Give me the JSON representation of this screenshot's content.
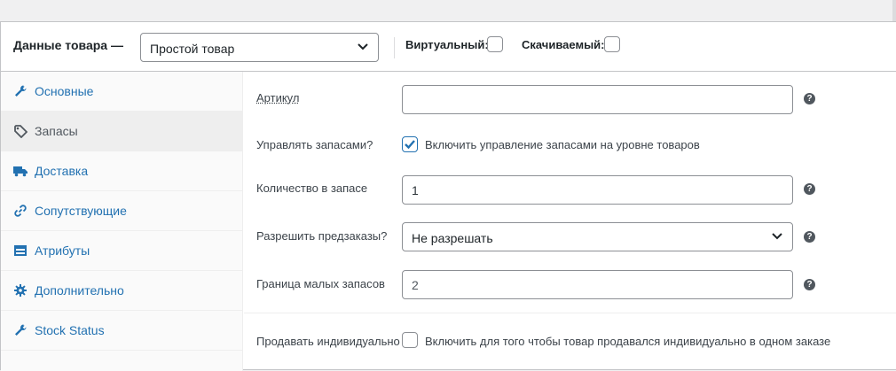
{
  "header": {
    "title": "Данные товара —",
    "product_type": {
      "selected": "Простой товар",
      "icon": "chevron-down-icon"
    },
    "virtual_label": "Виртуальный:",
    "virtual_checked": false,
    "downloadable_label": "Скачиваемый:",
    "downloadable_checked": false
  },
  "sidebar": {
    "items": [
      {
        "label": "Основные",
        "icon": "wrench-icon",
        "active": false
      },
      {
        "label": "Запасы",
        "icon": "tag-icon",
        "active": true
      },
      {
        "label": "Доставка",
        "icon": "truck-icon",
        "active": false
      },
      {
        "label": "Сопутствующие",
        "icon": "link-icon",
        "active": false
      },
      {
        "label": "Атрибуты",
        "icon": "table-icon",
        "active": false
      },
      {
        "label": "Дополнительно",
        "icon": "gear-icon",
        "active": false
      },
      {
        "label": "Stock Status",
        "icon": "wrench-icon",
        "active": false
      }
    ]
  },
  "inventory": {
    "sku": {
      "label": "Артикул",
      "value": ""
    },
    "manage_stock": {
      "label": "Управлять запасами?",
      "checked": true,
      "description": "Включить управление запасами на уровне товаров"
    },
    "stock_qty": {
      "label": "Количество в запасе",
      "value": "1"
    },
    "backorders": {
      "label": "Разрешить предзаказы?",
      "selected": "Не разрешать"
    },
    "low_stock": {
      "label": "Граница малых запасов",
      "placeholder": "2"
    },
    "sold_individually": {
      "label": "Продавать индивидуально",
      "checked": false,
      "description": "Включить для того чтобы товар продавался индивидуально в одном заказе"
    },
    "help_glyph": "?"
  },
  "colors": {
    "accent": "#2271b1",
    "border": "#8c8f94",
    "active_tab_bg": "#eeeeee"
  }
}
